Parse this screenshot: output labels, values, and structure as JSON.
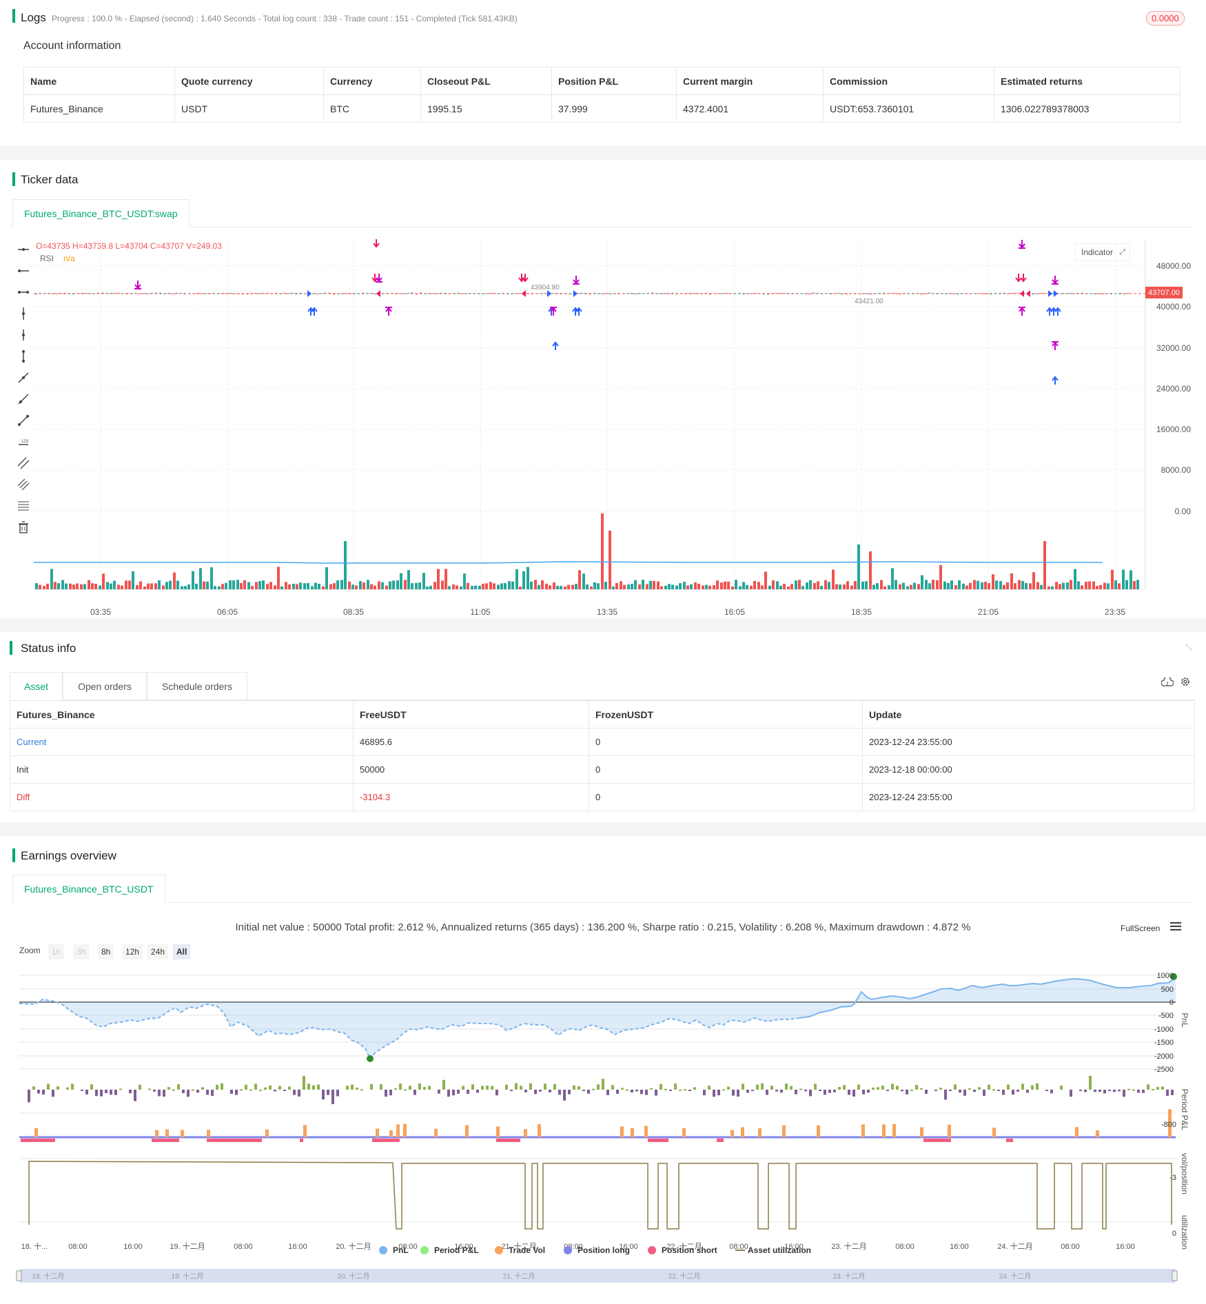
{
  "logs": {
    "title": "Logs",
    "summary": "Progress : 100.0 % - Elapsed (second) : 1.640  Seconds - Total log count : 338 - Trade count : 151 - Completed (Tick 581.43KB)",
    "badge": "0.0000"
  },
  "account": {
    "title": "Account information",
    "headers": [
      "Name",
      "Quote currency",
      "Currency",
      "Closeout P&L",
      "Position P&L",
      "Current margin",
      "Commission",
      "Estimated returns"
    ],
    "row": [
      "Futures_Binance",
      "USDT",
      "BTC",
      "1995.15",
      "37.999",
      "4372.4001",
      "USDT:653.7360101",
      "1306.022789378003"
    ]
  },
  "ticker": {
    "title": "Ticker data",
    "tab": "Futures_Binance_BTC_USDT:swap",
    "ohlc": "O=43735 H=43739.8 L=43704 C=43707 V=249.03",
    "rsi_label": "RSI",
    "rsi_value": "n/a",
    "indicator_btn": "Indicator",
    "price_tag": "43707.00",
    "y_ticks": [
      "48000.00",
      "40000.00",
      "32000.00",
      "24000.00",
      "16000.00",
      "8000.00",
      "0.00"
    ],
    "x_ticks": [
      "03:35",
      "06:05",
      "08:35",
      "11:05",
      "13:35",
      "16:05",
      "18:35",
      "21:05",
      "23:35"
    ],
    "annot_a": "43904.80",
    "annot_b": "43421.00"
  },
  "status": {
    "title": "Status info",
    "tabs": [
      "Asset",
      "Open orders",
      "Schedule orders"
    ],
    "headers": [
      "Futures_Binance",
      "FreeUSDT",
      "FrozenUSDT",
      "Update"
    ],
    "rows": [
      [
        "Current",
        "46895.6",
        "0",
        "2023-12-24 23:55:00"
      ],
      [
        "Init",
        "50000",
        "0",
        "2023-12-18 00:00:00"
      ],
      [
        "Diff",
        "-3104.3",
        "0",
        "2023-12-24 23:55:00"
      ]
    ]
  },
  "earnings": {
    "title": "Earnings overview",
    "tab": "Futures_Binance_BTC_USDT",
    "summary": "Initial net value : 50000 Total profit: 2.612 %, Annualized returns (365 days) : 136.200 %, Sharpe ratio : 0.215, Volatility : 6.208 %, Maximum drawdown : 4.872 %",
    "fullscreen": "FullScreen",
    "zoom_label": "Zoom",
    "zoom_btns": [
      "1h",
      "3h",
      "8h",
      "12h",
      "24h",
      "All"
    ],
    "pnl_ticks": [
      "1000",
      "500",
      "0",
      "-500",
      "-1000",
      "-1500",
      "-2000",
      "-2500"
    ],
    "ppl_tick": "-800",
    "vol_tick": "-3",
    "util_tick": "0",
    "x_ticks": [
      "18. 十...",
      "08:00",
      "16:00",
      "19. 十二月",
      "08:00",
      "16:00",
      "20. 十二月",
      "08:00",
      "16:00",
      "21. 十二月",
      "08:00",
      "16:00",
      "22. 十二月",
      "08:00",
      "16:00",
      "23. 十二月",
      "08:00",
      "16:00",
      "24. 十二月",
      "08:00",
      "16:00"
    ],
    "nav_ticks": [
      "18. 十二月",
      "19. 十二月",
      "20. 十二月",
      "21. 十二月",
      "22. 十二月",
      "23. 十二月",
      "24. 十二月"
    ],
    "axis_labels": [
      "PnL",
      "Period P&L",
      "vol/position",
      "utilization"
    ],
    "legend": [
      "PnL",
      "Period P&L",
      "Trade Vol",
      "Position long",
      "Position short",
      "Asset utilization"
    ],
    "legend_colors": [
      "#7cb5ec",
      "#90ed7d",
      "#f7a35c",
      "#8085e9",
      "#f15c80",
      "#8d7a4a"
    ]
  },
  "colors": {
    "accent": "#00a870",
    "up": "#26a69a",
    "down": "#ef5350",
    "long": "#2962ff",
    "short": "#e91e63",
    "close": "#c800c8"
  }
}
